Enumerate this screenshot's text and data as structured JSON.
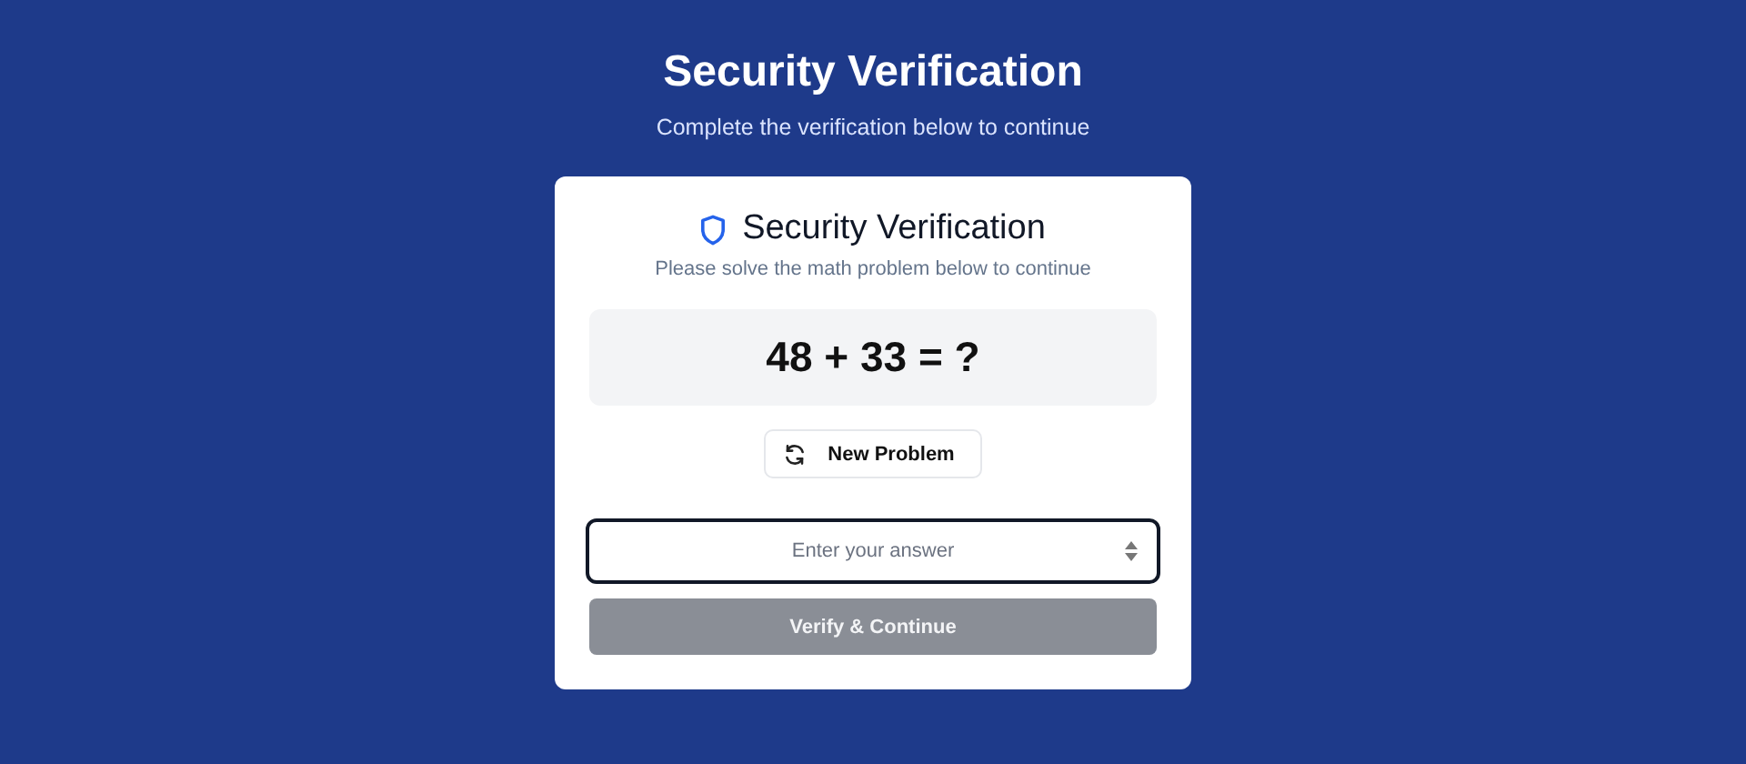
{
  "page": {
    "title": "Security Verification",
    "subtitle": "Complete the verification below to continue"
  },
  "card": {
    "title": "Security Verification",
    "subtitle": "Please solve the math problem below to continue",
    "problem": "48 + 33 = ?",
    "new_problem_button": {
      "label": "New Problem"
    },
    "answer_field": {
      "placeholder": "Enter your answer",
      "focused": true
    },
    "submit_button": {
      "label": "Verify & Continue",
      "disabled": true
    }
  }
}
